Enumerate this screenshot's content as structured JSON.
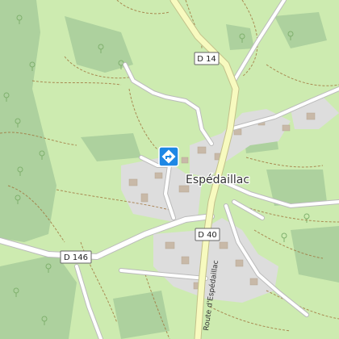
{
  "map": {
    "place_name": "Espédaillac",
    "road_labels": {
      "d14": "D 14",
      "d40": "D 40",
      "d146": "D 146"
    },
    "street_label": "Route d'Espédaillac",
    "marker": {
      "icon": "diamond-direction-icon",
      "color": "#1e88e5"
    },
    "colors": {
      "meadow": "#cdebb0",
      "forest": "#add19e",
      "residential": "#dddddd",
      "major_road": "#f7fabf",
      "road_casing": "#c2c08a",
      "minor_road": "#ffffff",
      "track": "#a0733b"
    }
  }
}
